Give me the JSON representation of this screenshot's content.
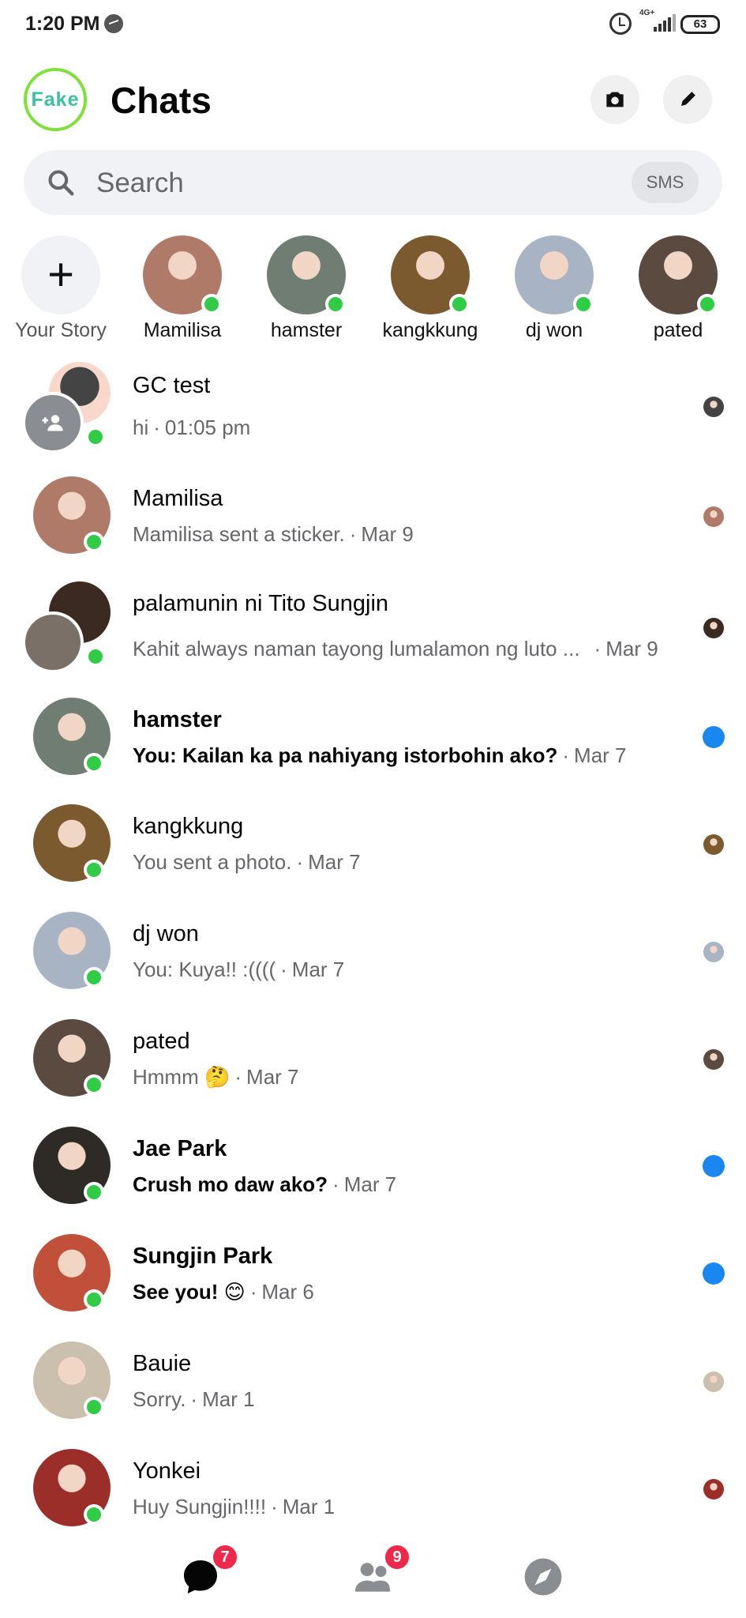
{
  "status_bar": {
    "time": "1:20 PM",
    "network": "4G+",
    "battery": "63",
    "icons": [
      "messenger-icon",
      "alarm-icon",
      "signal-icon",
      "battery-icon"
    ]
  },
  "header": {
    "logo_text": "Fake",
    "title": "Chats",
    "camera_icon": "camera-icon",
    "compose_icon": "pencil-icon"
  },
  "search": {
    "placeholder": "Search",
    "sms_label": "SMS"
  },
  "stories": {
    "add_label": "Your Story",
    "items": [
      {
        "name": "Mamilisa",
        "color": "#b07a68"
      },
      {
        "name": "hamster",
        "color": "#6f7d72"
      },
      {
        "name": "kangkkung",
        "color": "#7a5a2e"
      },
      {
        "name": "dj won",
        "color": "#a8b4c4"
      },
      {
        "name": "pated",
        "color": "#5a4a40"
      }
    ]
  },
  "chats": [
    {
      "name": "GC test",
      "message": "hi",
      "time": "01:05 pm",
      "unread": false,
      "group": true,
      "color": "#444444"
    },
    {
      "name": "Mamilisa",
      "message": "Mamilisa sent a sticker.",
      "time": "Mar 9",
      "unread": false,
      "color": "#b07a68"
    },
    {
      "name": "palamunin ni Tito Sungjin",
      "message": "Kahit always naman tayong lumalamon ng luto ...",
      "time": "Mar 9",
      "unread": false,
      "group": true,
      "color": "#3a2a22"
    },
    {
      "name": "hamster",
      "message": "You: Kailan ka pa nahiyang istorbohin ako?",
      "time": "Mar 7",
      "unread": true,
      "color": "#6f7d72"
    },
    {
      "name": "kangkkung",
      "message": "You sent a photo.",
      "time": "Mar 7",
      "unread": false,
      "color": "#7a5a2e"
    },
    {
      "name": "dj won",
      "message": "You: Kuya!! :((((",
      "time": "Mar 7",
      "unread": false,
      "color": "#a8b4c4"
    },
    {
      "name": "pated",
      "message": "Hmmm 🤔",
      "time": "Mar 7",
      "unread": false,
      "color": "#5a4a40"
    },
    {
      "name": "Jae Park",
      "message": "Crush mo daw ako?",
      "time": "Mar 7",
      "unread": true,
      "color": "#2e2a26"
    },
    {
      "name": "Sungjin Park",
      "message": "See you! 😊",
      "time": "Mar 6",
      "unread": true,
      "color": "#c0503a"
    },
    {
      "name": "Bauie",
      "message": "Sorry.",
      "time": "Mar 1",
      "unread": false,
      "color": "#cbbfae"
    },
    {
      "name": "Yonkei",
      "message": "Huy Sungjin!!!!",
      "time": "Mar 1",
      "unread": false,
      "color": "#9c2e2a"
    }
  ],
  "bottom_nav": [
    {
      "name": "chats-tab",
      "icon": "chat-bubble-icon",
      "badge": "7",
      "active": true
    },
    {
      "name": "people-tab",
      "icon": "people-icon",
      "badge": "9",
      "active": false
    },
    {
      "name": "discover-tab",
      "icon": "compass-icon",
      "badge": "",
      "active": false
    }
  ],
  "colors": {
    "accent": "#1a86f0",
    "online": "#31cc46",
    "badge": "#f02849",
    "logo_ring": "#7fe03a"
  }
}
